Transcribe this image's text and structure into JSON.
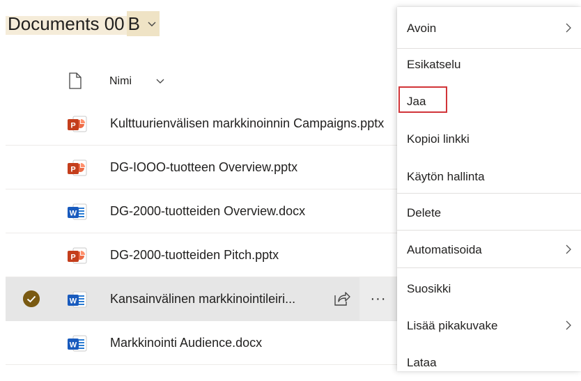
{
  "library": {
    "title_part1": "Documents 00",
    "title_part2": "B"
  },
  "header": {
    "name_column": "Nimi"
  },
  "files": [
    {
      "name": "Kulttuurienvälisen markkinoinnin Campaigns.pptx",
      "type": "pptx",
      "icon": "powerpoint-icon"
    },
    {
      "name": "DG-IOOO-tuotteen Overview.pptx",
      "type": "pptx",
      "icon": "powerpoint-icon"
    },
    {
      "name": "DG-2000-tuotteiden Overview.docx",
      "type": "docx",
      "icon": "word-icon"
    },
    {
      "name": "DG-2000-tuotteiden Pitch.pptx",
      "type": "pptx",
      "icon": "powerpoint-icon"
    },
    {
      "name": "Kansainvälinen markkinointileiri...",
      "type": "docx",
      "icon": "word-icon",
      "selected": true
    },
    {
      "name": "Markkinointi Audience.docx",
      "type": "docx",
      "icon": "word-icon"
    }
  ],
  "row_actions": {
    "more_label": "···"
  },
  "context_menu": {
    "items": [
      {
        "label": "Avoin",
        "submenu": true
      },
      {
        "label": "Esikatselu",
        "submenu": false
      },
      {
        "label": "Jaa",
        "submenu": false,
        "highlighted": true
      },
      {
        "label": "Kopioi linkki",
        "submenu": false
      },
      {
        "label": "Käytön hallinta",
        "submenu": false
      },
      {
        "label": "Delete",
        "submenu": false
      },
      {
        "label": "Automatisoida",
        "submenu": true
      },
      {
        "label": "Suosikki",
        "submenu": false
      },
      {
        "label": "Lisää pikakuvake",
        "submenu": true
      },
      {
        "label": "Lataa",
        "submenu": false
      }
    ]
  },
  "colors": {
    "accent_check": "#7a5a12",
    "highlight_box": "#d13438",
    "selected_row": "#e6e6e6",
    "powerpoint": "#c43e1c",
    "word": "#185abd"
  }
}
